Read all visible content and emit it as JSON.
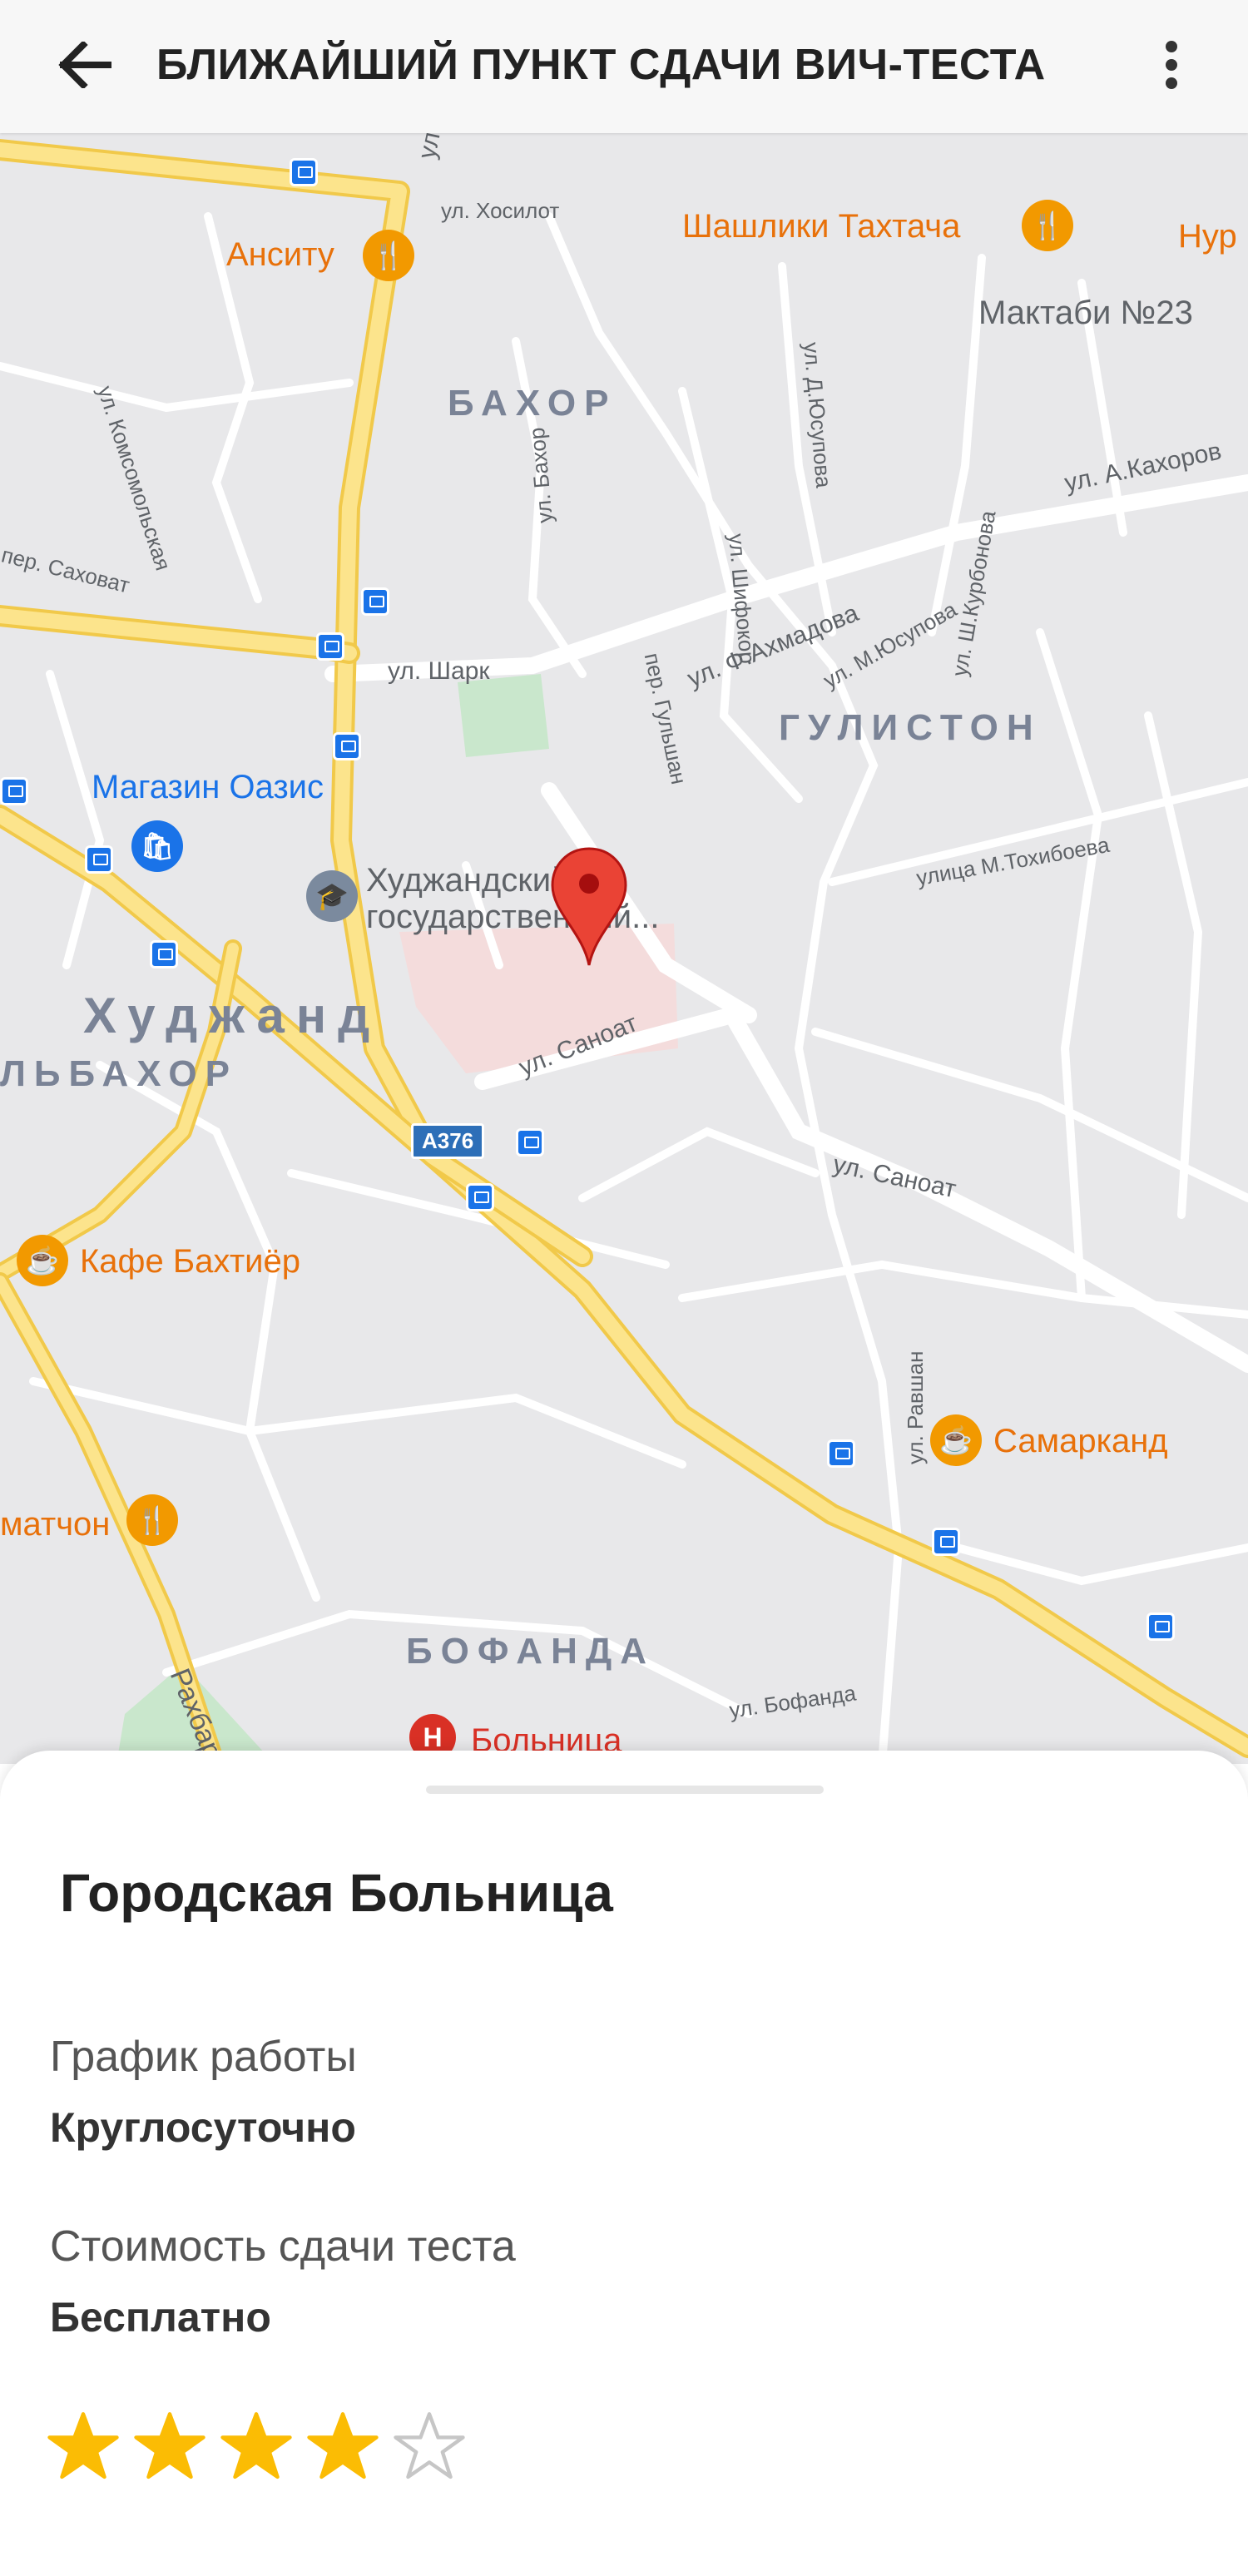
{
  "appbar": {
    "title": "БЛИЖАЙШИЙ ПУНКТ СДАЧИ ВИЧ-ТЕСТА",
    "back_icon": "arrow-back-icon",
    "menu_icon": "more-vert-icon"
  },
  "map": {
    "streets": [
      "ул. Хосилот",
      "ул. Комсомольская",
      "ул. Шифокор",
      "ул. Д.Юсупова",
      "ул. А.Кахоров",
      "ул. Ф.Ахмадова",
      "ул. М.Юсупова",
      "ул. Ш.Курбонова",
      "пер. Саховат",
      "ул. Бахор",
      "ул. Шарк",
      "пер. Гульшан",
      "улица М.Тохибоева",
      "ул. Саноат",
      "ул. Саноат",
      "ул. Равшан",
      "ул. Бофанда",
      "улиц",
      "Рахбар"
    ],
    "districts": [
      "БАХОР",
      "ГУЛИСТОН",
      "Худжанд",
      "ЛЬБАХОР",
      "БОФАНДА"
    ],
    "pois": {
      "ansitu": "Анситу",
      "shashliki": "Шашлики Тахтача",
      "nur": "Нур",
      "maktabi": "Мактаби №23",
      "oazis": "Магазин Оазис",
      "university_line1": "Худжандский",
      "university_line2": "государственный...",
      "cafe": "Кафе Бахтиёр",
      "samarkand": "Самарканд",
      "matchon": "матчон",
      "hospital": "Больница"
    },
    "road_shield": "А376",
    "colors": {
      "road_major": "#fce48c",
      "road_major_edge": "#f1c94a",
      "road_minor": "#ffffff",
      "map_bg": "#e8e8ea",
      "pin": "#ea4335"
    }
  },
  "sheet": {
    "place_name": "Городская Больница",
    "hours_label": "График работы",
    "hours_value": "Круглосуточно",
    "cost_label": "Стоимость сдачи теста",
    "cost_value": "Бесплатно",
    "rating": 4,
    "rating_max": 5,
    "star_color": "#fbbc04"
  }
}
